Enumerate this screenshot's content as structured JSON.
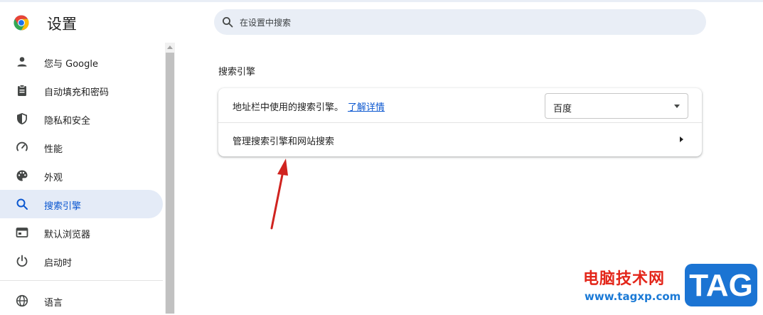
{
  "app": {
    "title": "设置"
  },
  "search": {
    "placeholder": "在设置中搜索"
  },
  "sidebar": {
    "items": [
      {
        "label": "您与 Google",
        "icon": "person-icon",
        "active": false
      },
      {
        "label": "自动填充和密码",
        "icon": "clipboard-icon",
        "active": false
      },
      {
        "label": "隐私和安全",
        "icon": "shield-icon",
        "active": false
      },
      {
        "label": "性能",
        "icon": "speedometer-icon",
        "active": false
      },
      {
        "label": "外观",
        "icon": "palette-icon",
        "active": false
      },
      {
        "label": "搜索引擎",
        "icon": "search-icon",
        "active": true
      },
      {
        "label": "默认浏览器",
        "icon": "browser-window-icon",
        "active": false
      },
      {
        "label": "启动时",
        "icon": "power-icon",
        "active": false
      },
      {
        "label": "语言",
        "icon": "globe-icon",
        "active": false
      }
    ]
  },
  "main": {
    "section_title": "搜索引擎",
    "address_bar_row": {
      "label": "地址栏中使用的搜索引擎。",
      "link": "了解详情",
      "selected_engine": "百度"
    },
    "manage_row": {
      "label": "管理搜索引擎和网站搜索"
    }
  },
  "watermark": {
    "site_name": "电脑技术网",
    "url": "www.tagxp.com",
    "badge": "TAG"
  },
  "colors": {
    "accent": "#0b57d0",
    "active_nav_bg": "#e4ebf7",
    "search_bg": "#e9eef6",
    "annotation_arrow": "#d0231f",
    "watermark_red": "#e3261a",
    "watermark_blue": "#1b74d3"
  }
}
